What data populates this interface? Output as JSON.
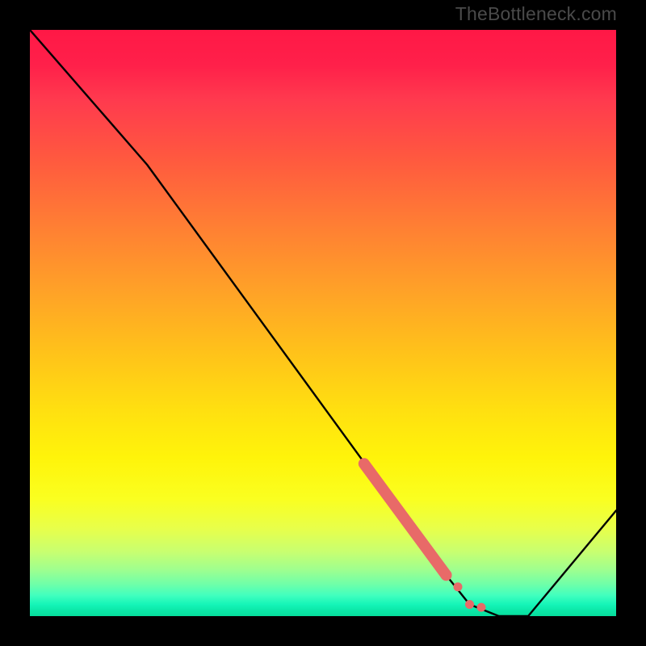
{
  "watermark": "TheBottleneck.com",
  "chart_data": {
    "type": "line",
    "title": "",
    "xlabel": "",
    "ylabel": "",
    "xlim": [
      0,
      100
    ],
    "ylim": [
      0,
      100
    ],
    "series": [
      {
        "name": "curve",
        "x": [
          0,
          20,
          71,
          75,
          80,
          85,
          100
        ],
        "values": [
          100,
          77,
          7,
          2,
          0,
          0,
          18
        ]
      }
    ],
    "highlight_segment": {
      "x": [
        57,
        71,
        73,
        75,
        77
      ],
      "values": [
        26,
        7,
        5,
        2,
        1.5
      ]
    },
    "highlight_color": "#e86a68",
    "gradient_stops": [
      {
        "pos": 0,
        "color": "#ff1846"
      },
      {
        "pos": 0.22,
        "color": "#ff593f"
      },
      {
        "pos": 0.55,
        "color": "#ffc21a"
      },
      {
        "pos": 0.8,
        "color": "#faff20"
      },
      {
        "pos": 0.96,
        "color": "#40ffbe"
      },
      {
        "pos": 1.0,
        "color": "#06dd9c"
      }
    ]
  }
}
